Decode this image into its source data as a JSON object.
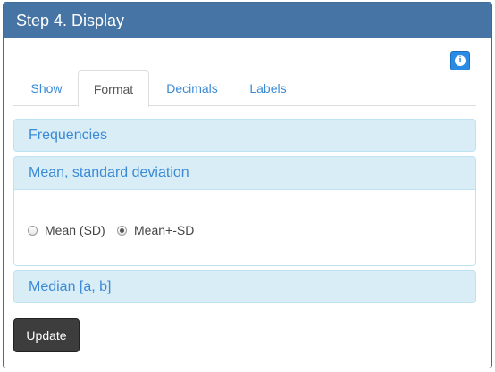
{
  "panel": {
    "title": "Step 4. Display"
  },
  "tabs": [
    {
      "label": "Show",
      "active": false
    },
    {
      "label": "Format",
      "active": true
    },
    {
      "label": "Decimals",
      "active": false
    },
    {
      "label": "Labels",
      "active": false
    }
  ],
  "accordion": [
    {
      "title": "Frequencies",
      "expanded": false
    },
    {
      "title": "Mean, standard deviation",
      "expanded": true
    },
    {
      "title": "Median [a, b]",
      "expanded": false
    }
  ],
  "mean_format": {
    "options": [
      {
        "label": "Mean (SD)",
        "selected": false
      },
      {
        "label": "Mean+-SD",
        "selected": true
      }
    ]
  },
  "buttons": {
    "update_label": "Update",
    "info_icon": "info-icon"
  },
  "colors": {
    "header_bg": "#4674a4",
    "accordion_bg": "#d9edf7",
    "link": "#3a8ad6",
    "info_button": "#2a8be4",
    "update_button": "#3d3d3d"
  }
}
